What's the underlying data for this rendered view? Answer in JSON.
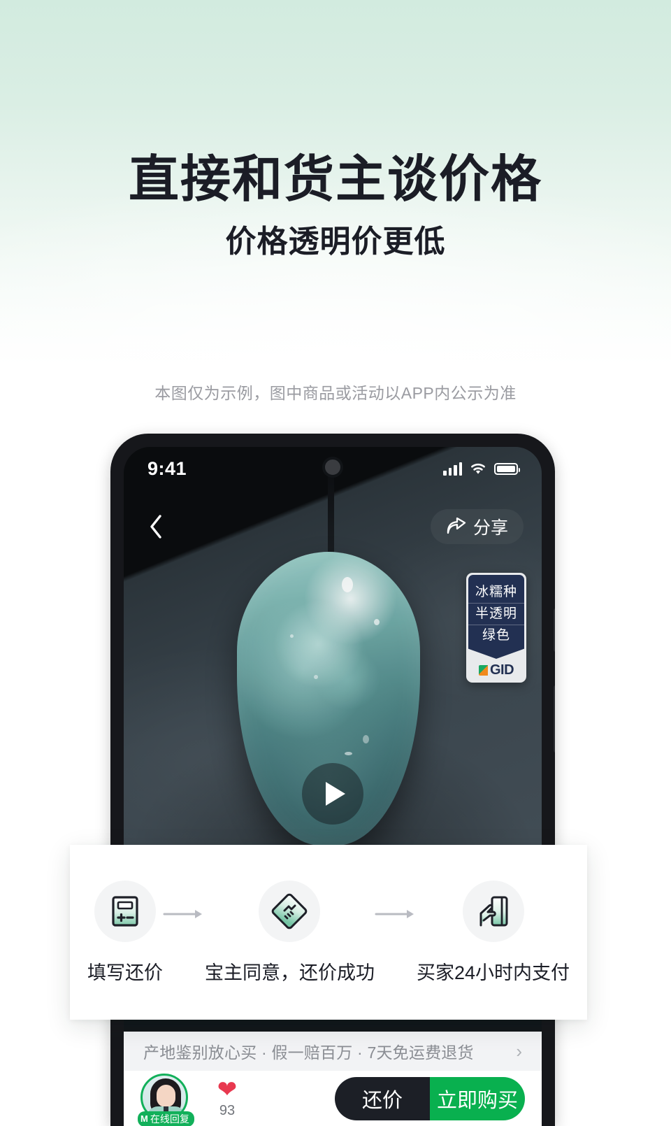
{
  "promo": {
    "headline": "直接和货主谈价格",
    "subheadline": "价格透明价更低",
    "disclaimer": "本图仅为示例，图中商品或活动以APP内公示为准",
    "accent_green": "#09b04f",
    "bg_gradient_top": "#d2ebdf"
  },
  "phone": {
    "status_bar": {
      "time": "9:41",
      "signal_icon": "signal-bars-icon",
      "wifi_icon": "wifi-icon",
      "battery_icon": "battery-icon"
    },
    "nav": {
      "back_icon": "chevron-left-icon",
      "share_icon": "share-arrow-icon",
      "share_label": "分享"
    },
    "media": {
      "play_icon": "play-icon"
    },
    "gid_badge": {
      "rows": [
        "冰糯种",
        "半透明",
        "绿色"
      ],
      "logo_text": "GID",
      "logo_mark": "gid-logo-mark"
    },
    "service_bar": {
      "text": "产地鉴别放心买 · 假一赔百万 · 7天免运费退货",
      "chevron": "›"
    },
    "action_bar": {
      "seller_badge": "在线回复",
      "seller_badge_mark": "M",
      "favorite_icon": "heart-icon",
      "favorite_count": "93",
      "counter_offer_label": "还价",
      "buy_now_label": "立即购买"
    }
  },
  "steps": {
    "arrow_icon": "arrow-right-icon",
    "items": [
      {
        "icon": "calculator-icon",
        "label": "填写还价"
      },
      {
        "icon": "handshake-icon",
        "label": "宝主同意，还价成功"
      },
      {
        "icon": "hand-card-icon",
        "label": "买家24小时内支付"
      }
    ]
  }
}
